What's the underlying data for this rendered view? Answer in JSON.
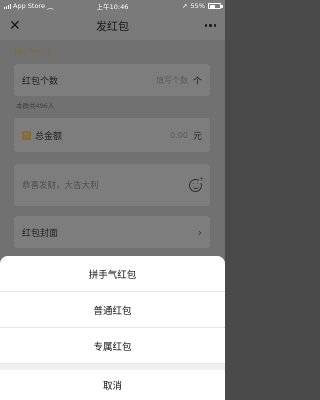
{
  "status_bar": {
    "carrier": "App Store",
    "time": "上午10:46",
    "battery": "55%",
    "battery_level": 0.55
  },
  "nav": {
    "title": "发红包"
  },
  "form": {
    "type_picker": "拼手气红包",
    "count_label": "红包个数",
    "count_placeholder": "填写个数",
    "count_unit": "个",
    "group_hint": "本群共496人",
    "amount_label": "总金额",
    "amount_value": "0.00",
    "amount_unit": "元",
    "greeting_placeholder": "恭喜发财，大吉大利",
    "cover_label": "红包封面"
  },
  "sheet": {
    "options": [
      {
        "label": "拼手气红包"
      },
      {
        "label": "普通红包"
      },
      {
        "label": "专属红包"
      }
    ],
    "cancel": "取消"
  }
}
